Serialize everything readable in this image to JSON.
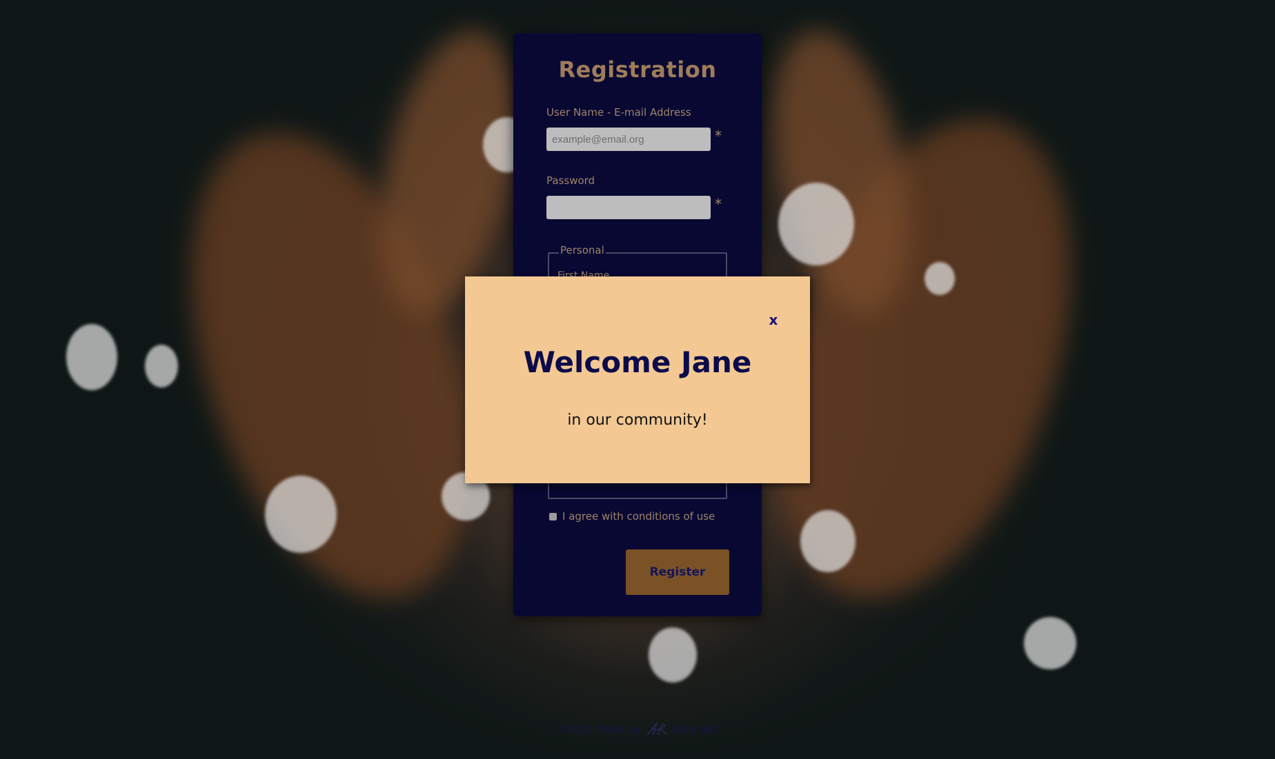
{
  "registration": {
    "title": "Registration",
    "email_label": "User Name - E-mail Address",
    "email_placeholder": "example@email.org",
    "email_value": "",
    "password_label": "Password",
    "password_value": "",
    "required_marker": "*",
    "fieldset_legend": "Personal",
    "first_name_label": "First Name",
    "agree_label": "I agree with conditions of use",
    "register_label": "Register"
  },
  "modal": {
    "close_label": "x",
    "title": "Welcome Jane",
    "subtitle": "in our community!"
  },
  "footer": {
    "prefix": "©2020 Made by",
    "author": "Alice Rez"
  },
  "colors": {
    "card_bg": "#080833",
    "accent_brown": "#a07c5a",
    "button_bg": "#7a5226",
    "modal_bg": "#f3c893",
    "modal_title": "#0b0b4a"
  }
}
